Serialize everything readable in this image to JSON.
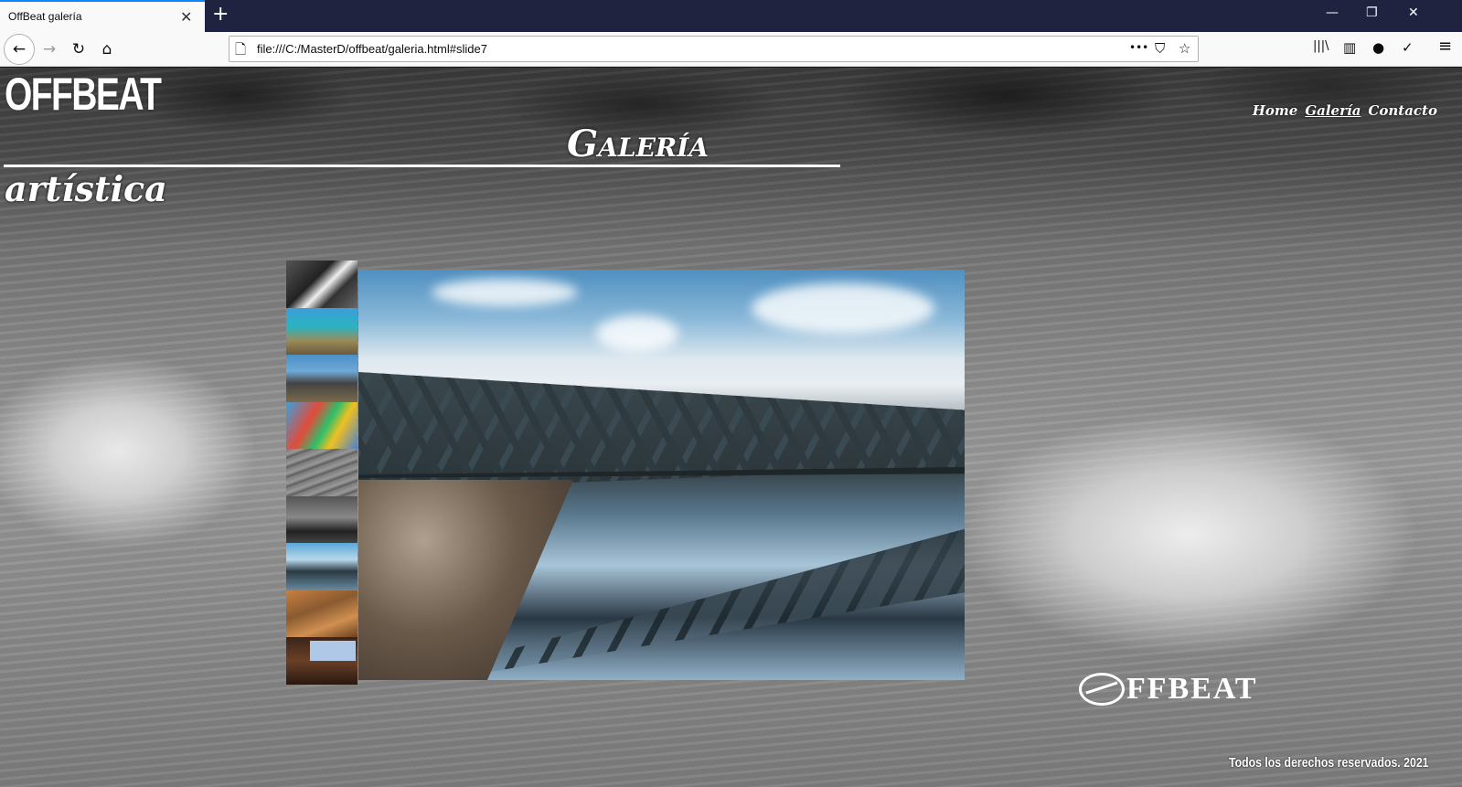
{
  "browser": {
    "tab_title": "OffBeat galería",
    "tab_close": "✕",
    "new_tab": "+",
    "url": "file:///C:/MasterD/offbeat/galeria.html#slide7",
    "window_controls": {
      "minimize": "—",
      "restore": "❐",
      "close": "✕"
    },
    "icons": {
      "back": "←",
      "forward": "→",
      "reload": "↻",
      "home": "⌂",
      "page": "🗋",
      "more": "•••",
      "pocket": "⛉",
      "bookmark": "☆",
      "library": "|||\\",
      "sidebar": "▥",
      "account": "●",
      "sync": "✓",
      "menu": "≡"
    }
  },
  "site": {
    "brand": "OFFBEAT",
    "nav": [
      {
        "label": "Home",
        "active": false
      },
      {
        "label": "Galería",
        "active": true
      },
      {
        "label": "Contacto",
        "active": false
      }
    ],
    "title_word1": "Galería",
    "title_word2": "artística"
  },
  "gallery": {
    "current_slide": 7,
    "thumb_count": 9,
    "thumbs": [
      "harmonica",
      "beach-rocks",
      "sea-rocks",
      "colored-cube",
      "architecture",
      "shore-bw",
      "bridge",
      "rusted-metal",
      "window-wall"
    ],
    "main_image": "bridge"
  },
  "footer": {
    "logo_text": "FFBEAT",
    "copyright": "Todos los derechos reservados. 2021"
  }
}
